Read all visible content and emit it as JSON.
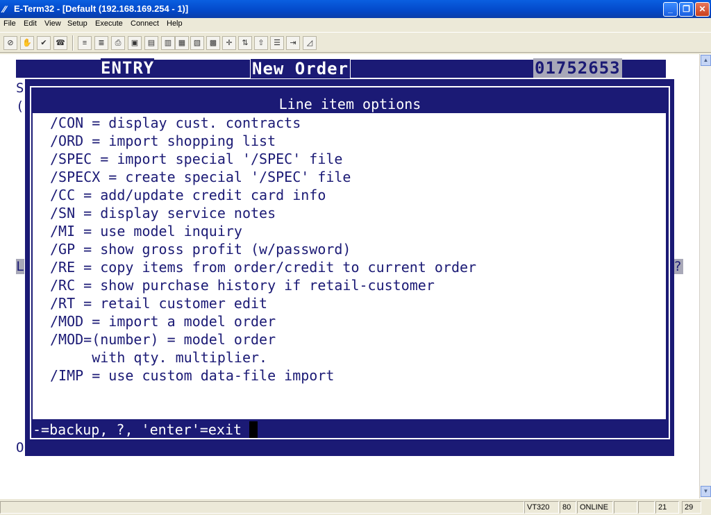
{
  "window": {
    "title": "E-Term32 - [Default (192.168.169.254 - 1)]",
    "minimize": "_",
    "restore": "❐",
    "close": "✕"
  },
  "menu": [
    "File",
    "Edit",
    "View",
    "Setup",
    "Execute",
    "Connect",
    "Help"
  ],
  "toolbar_icons": [
    "stop-icon",
    "hand-icon",
    "connect-icon",
    "disconnect-icon",
    "doc-icon",
    "doc2-icon",
    "print-icon",
    "copy-icon",
    "paste-icon",
    "paste2-icon",
    "screen1-icon",
    "screen2-icon",
    "keypad-icon",
    "crosshair-icon",
    "transfer-icon",
    "upload-icon",
    "script-icon",
    "exit-icon",
    "ruler-icon"
  ],
  "screen": {
    "entry": "ENTRY",
    "new_order": "New Order",
    "order_number": "01752653",
    "side_s": "S",
    "side_paren": "(",
    "side_l": "L",
    "side_q": "?",
    "side_o": "O"
  },
  "dialog": {
    "title": "Line item options",
    "options": [
      "/CON = display cust. contracts",
      "/ORD = import shopping list",
      "/SPEC = import special '/SPEC' file",
      "/SPECX = create special '/SPEC' file",
      "/CC = add/update credit card info",
      "/SN = display service notes",
      "/MI = use model inquiry",
      "/GP = show gross profit (w/password)",
      "/RE = copy items from order/credit to current order",
      "/RC = show purchase history if retail-customer",
      "/RT = retail customer edit",
      "/MOD = import a model order",
      "/MOD=(number) = model order",
      "     with qty. multiplier.",
      "/IMP = use custom data-file import"
    ],
    "footer": "-=backup, ?, 'enter'=exit"
  },
  "status": {
    "terminal_type": "VT320",
    "columns": "80",
    "state": "ONLINE",
    "row": "21",
    "col": "29"
  }
}
